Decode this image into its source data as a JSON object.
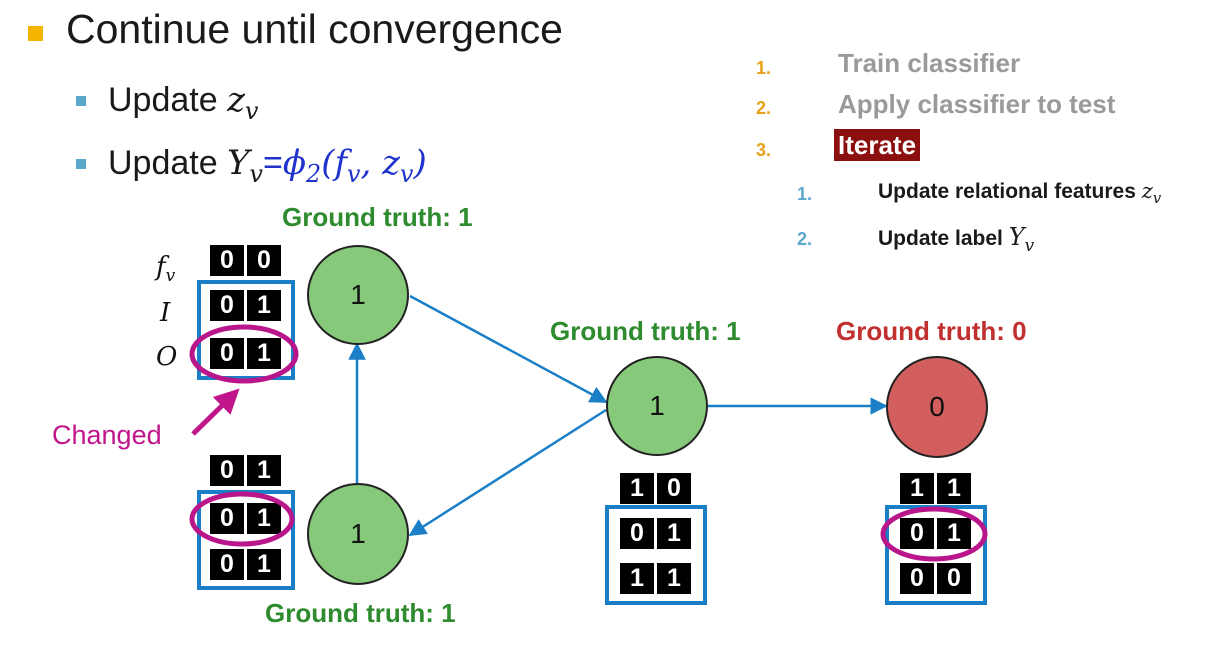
{
  "heading": "Continue until convergence",
  "bullets": {
    "update_z": {
      "label": "Update",
      "var": "z",
      "sub": "v"
    },
    "update_y": {
      "label": "Update",
      "lhs": "Y",
      "lhs_sub": "v",
      "eq": "=",
      "fn": "ϕ",
      "fn_sub": "2",
      "args": "(f",
      "args_sub1": "v",
      "args_mid": ", z",
      "args_sub2": "v",
      "args_end": ")"
    }
  },
  "steps": {
    "items": [
      {
        "num": "1.",
        "label": "Train classifier"
      },
      {
        "num": "2.",
        "label": "Apply classifier to test"
      },
      {
        "num": "3.",
        "label": "Iterate"
      }
    ],
    "subitems": [
      {
        "num": "1.",
        "label": "Update relational features",
        "var": "z",
        "sub": "v"
      },
      {
        "num": "2.",
        "label": "Update label",
        "var": "Y",
        "sub": "v"
      }
    ]
  },
  "row_labels": {
    "f": "f",
    "f_sub": "v",
    "i": "I",
    "o": "O"
  },
  "annotation": "Changed",
  "nodes": [
    {
      "id": "top-left",
      "label": "1",
      "ground_truth": "Ground truth: 1",
      "color": "#86c97a",
      "rows": [
        [
          "0",
          "0"
        ],
        [
          "0",
          "1"
        ],
        [
          "0",
          "1"
        ]
      ]
    },
    {
      "id": "bottom-left",
      "label": "1",
      "ground_truth": "Ground truth: 1",
      "color": "#86c97a",
      "rows": [
        [
          "0",
          "1"
        ],
        [
          "0",
          "1"
        ],
        [
          "0",
          "1"
        ]
      ]
    },
    {
      "id": "middle",
      "label": "1",
      "ground_truth": "Ground truth: 1",
      "color": "#86c97a",
      "rows": [
        [
          "1",
          "0"
        ],
        [
          "0",
          "1"
        ],
        [
          "1",
          "1"
        ]
      ]
    },
    {
      "id": "right",
      "label": "0",
      "ground_truth": "Ground truth: 0",
      "color": "#d25e5e",
      "rows": [
        [
          "1",
          "1"
        ],
        [
          "0",
          "1"
        ],
        [
          "0",
          "0"
        ]
      ]
    }
  ],
  "colors": {
    "accent_blue": "#1a7fc6",
    "highlight_magenta": "#b8168a",
    "green_text": "#2e8b2e",
    "red_text": "#c0302e"
  }
}
